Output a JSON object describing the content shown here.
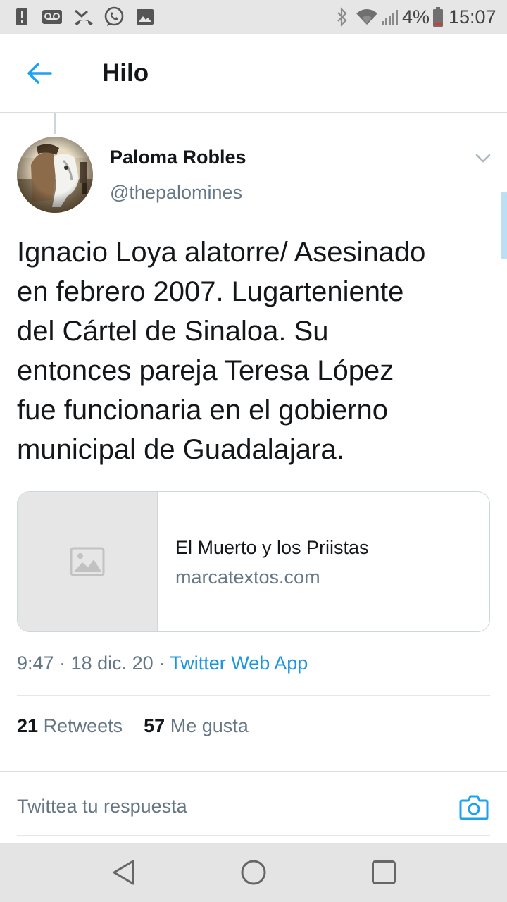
{
  "status_bar": {
    "time": "15:07",
    "battery_percent": "4%",
    "left_icons": [
      "alert-icon",
      "voicemail-icon",
      "missed-call-icon",
      "whatsapp-icon",
      "image-icon"
    ],
    "right_icons": [
      "bluetooth-icon",
      "wifi-icon",
      "signal-icon",
      "battery-icon"
    ]
  },
  "app_bar": {
    "title": "Hilo",
    "back_icon": "arrow-left-icon"
  },
  "tweet": {
    "author_name": "Paloma Robles",
    "author_handle": "@thepalomines",
    "text": "Ignacio Loya alatorre/ Asesinado\nen febrero 2007. Lugarteniente\ndel Cártel de Sinaloa. Su\nentonces pareja Teresa López\nfue funcionaria en el gobierno\nmunicipal de Guadalajara.",
    "card": {
      "title": "El Muerto y los Priistas",
      "domain": "marcatextos.com"
    },
    "time": "9:47",
    "date": "18 dic. 20",
    "separator": "·",
    "source": "Twitter Web App",
    "retweets_count": "21",
    "retweets_label": "Retweets",
    "likes_count": "57",
    "likes_label": "Me gusta"
  },
  "reply": {
    "placeholder": "Twittea tu respuesta"
  },
  "colors": {
    "accent": "#1da1f2",
    "link": "#1b95e0",
    "secondary_text": "#657786",
    "primary_text": "#14171a"
  }
}
